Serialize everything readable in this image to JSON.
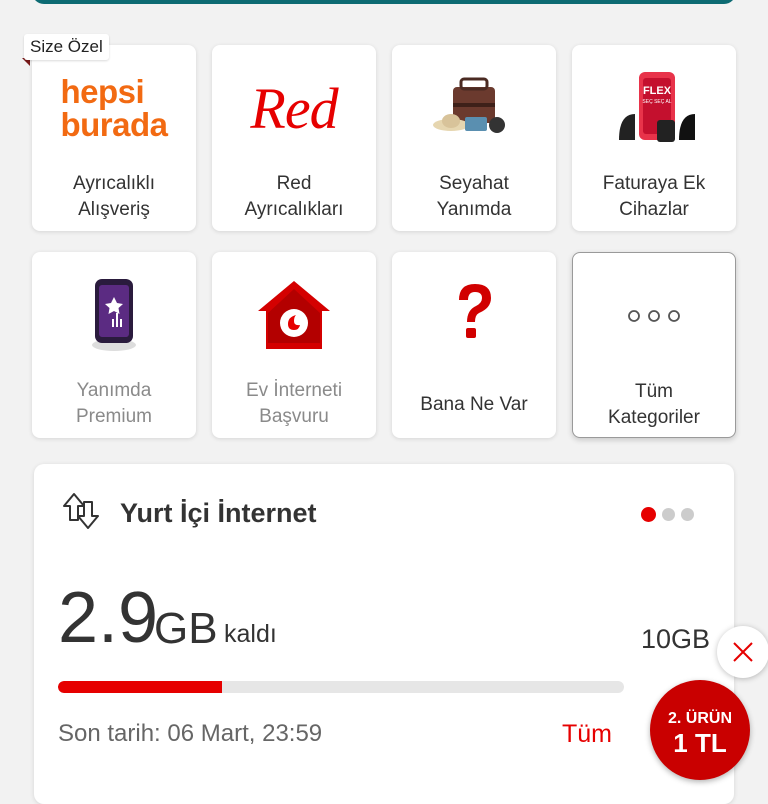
{
  "badge": "Size Özel",
  "tiles": [
    {
      "line1": "Ayrıcalıklı",
      "line2": "Alışveriş",
      "logo1": "hepsi",
      "logo2": "burada"
    },
    {
      "line1": "Red",
      "line2": "Ayrıcalıkları",
      "logo": "Red"
    },
    {
      "line1": "Seyahat",
      "line2": "Yanımda"
    },
    {
      "line1": "Faturaya Ek",
      "line2": "Cihazlar",
      "logo1": "FLEX",
      "logo2": "SEÇ SEÇ AL"
    },
    {
      "line1": "Yanımda",
      "line2": "Premium"
    },
    {
      "line1": "Ev İnterneti",
      "line2": "Başvuru"
    },
    {
      "line1": "Bana Ne Var"
    },
    {
      "line1": "Tüm",
      "line2": "Kategoriler",
      "icon": "ooo"
    }
  ],
  "usage": {
    "title": "Yurt İçi İnternet",
    "amount": "2.9",
    "unit": "GB",
    "suffix": "kaldı",
    "total": "10GB",
    "fraction_used": 0.29,
    "deadline": "Son tarih: 06 Mart, 23:59",
    "all_link": "Tüm"
  },
  "promo": {
    "line1": "2. ÜRÜN",
    "line2": "1 TL"
  },
  "colors": {
    "brand_red": "#e60000",
    "hepsiburada": "#f26a12"
  }
}
